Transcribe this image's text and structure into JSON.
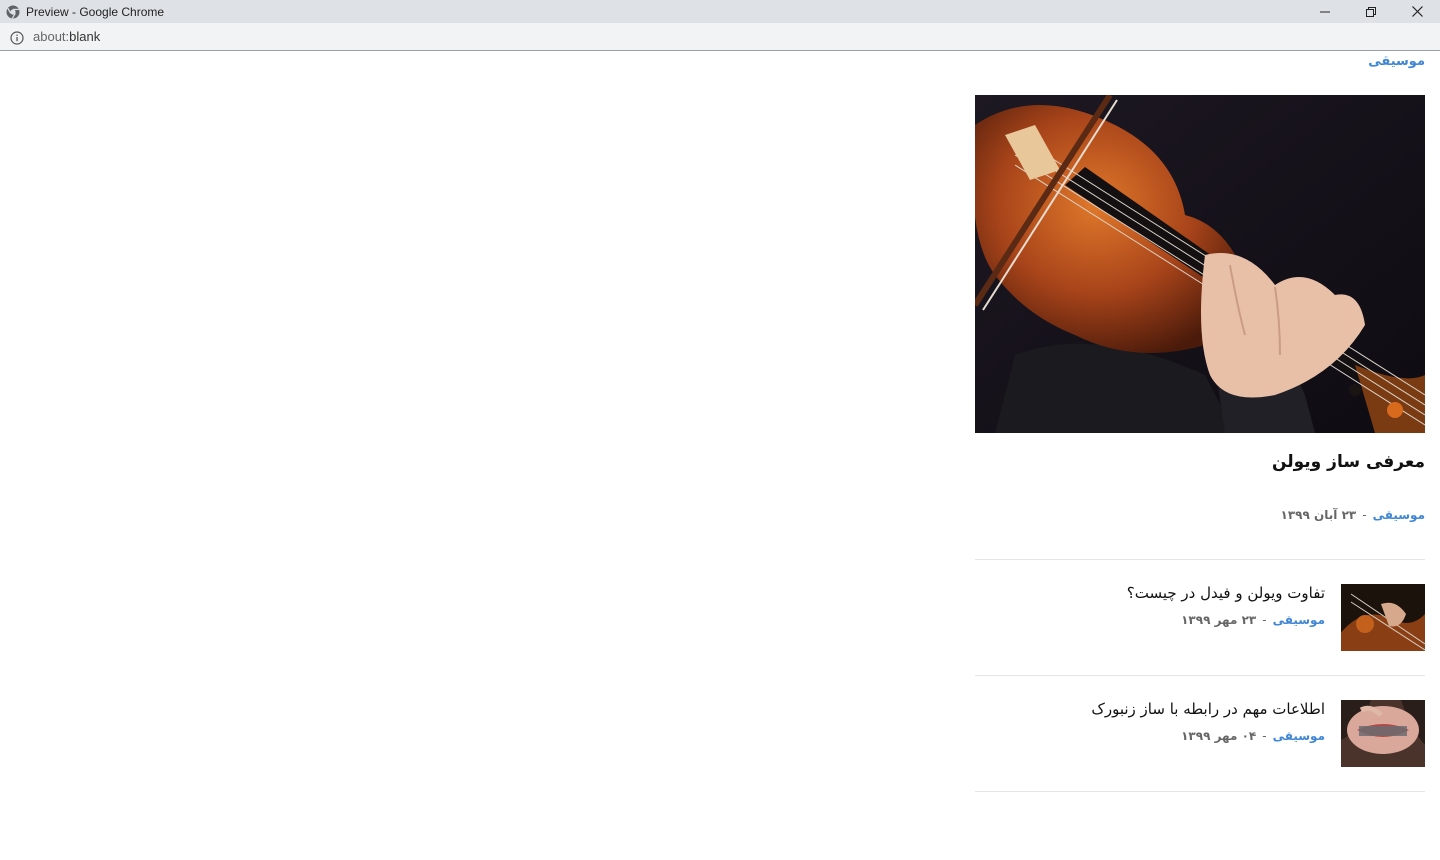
{
  "window": {
    "title": "Preview - Google Chrome",
    "url_scheme": "about:",
    "url_path": "blank"
  },
  "widget": {
    "category_label": "موسیقی",
    "feature": {
      "title": "معرفی ساز ویولن",
      "category": "موسیقی",
      "separator": "-",
      "date": "۲۳ آبان ۱۳۹۹"
    },
    "items": [
      {
        "title": "تفاوت ویولن و فیدل در چیست؟",
        "category": "موسیقی",
        "separator": "-",
        "date": "۲۳ مهر ۱۳۹۹"
      },
      {
        "title": "اطلاعات مهم در رابطه با ساز زنبورک",
        "category": "موسیقی",
        "separator": "-",
        "date": "۰۴ مهر ۱۳۹۹"
      }
    ]
  },
  "colors": {
    "accent": "#3f86d4",
    "titlebar": "#dee1e6",
    "addressbar": "#f1f3f4"
  },
  "icons": {
    "browser": "chrome-icon",
    "info": "info-icon",
    "minimize": "minimize-icon",
    "maximize": "restore-icon",
    "close": "close-icon"
  }
}
